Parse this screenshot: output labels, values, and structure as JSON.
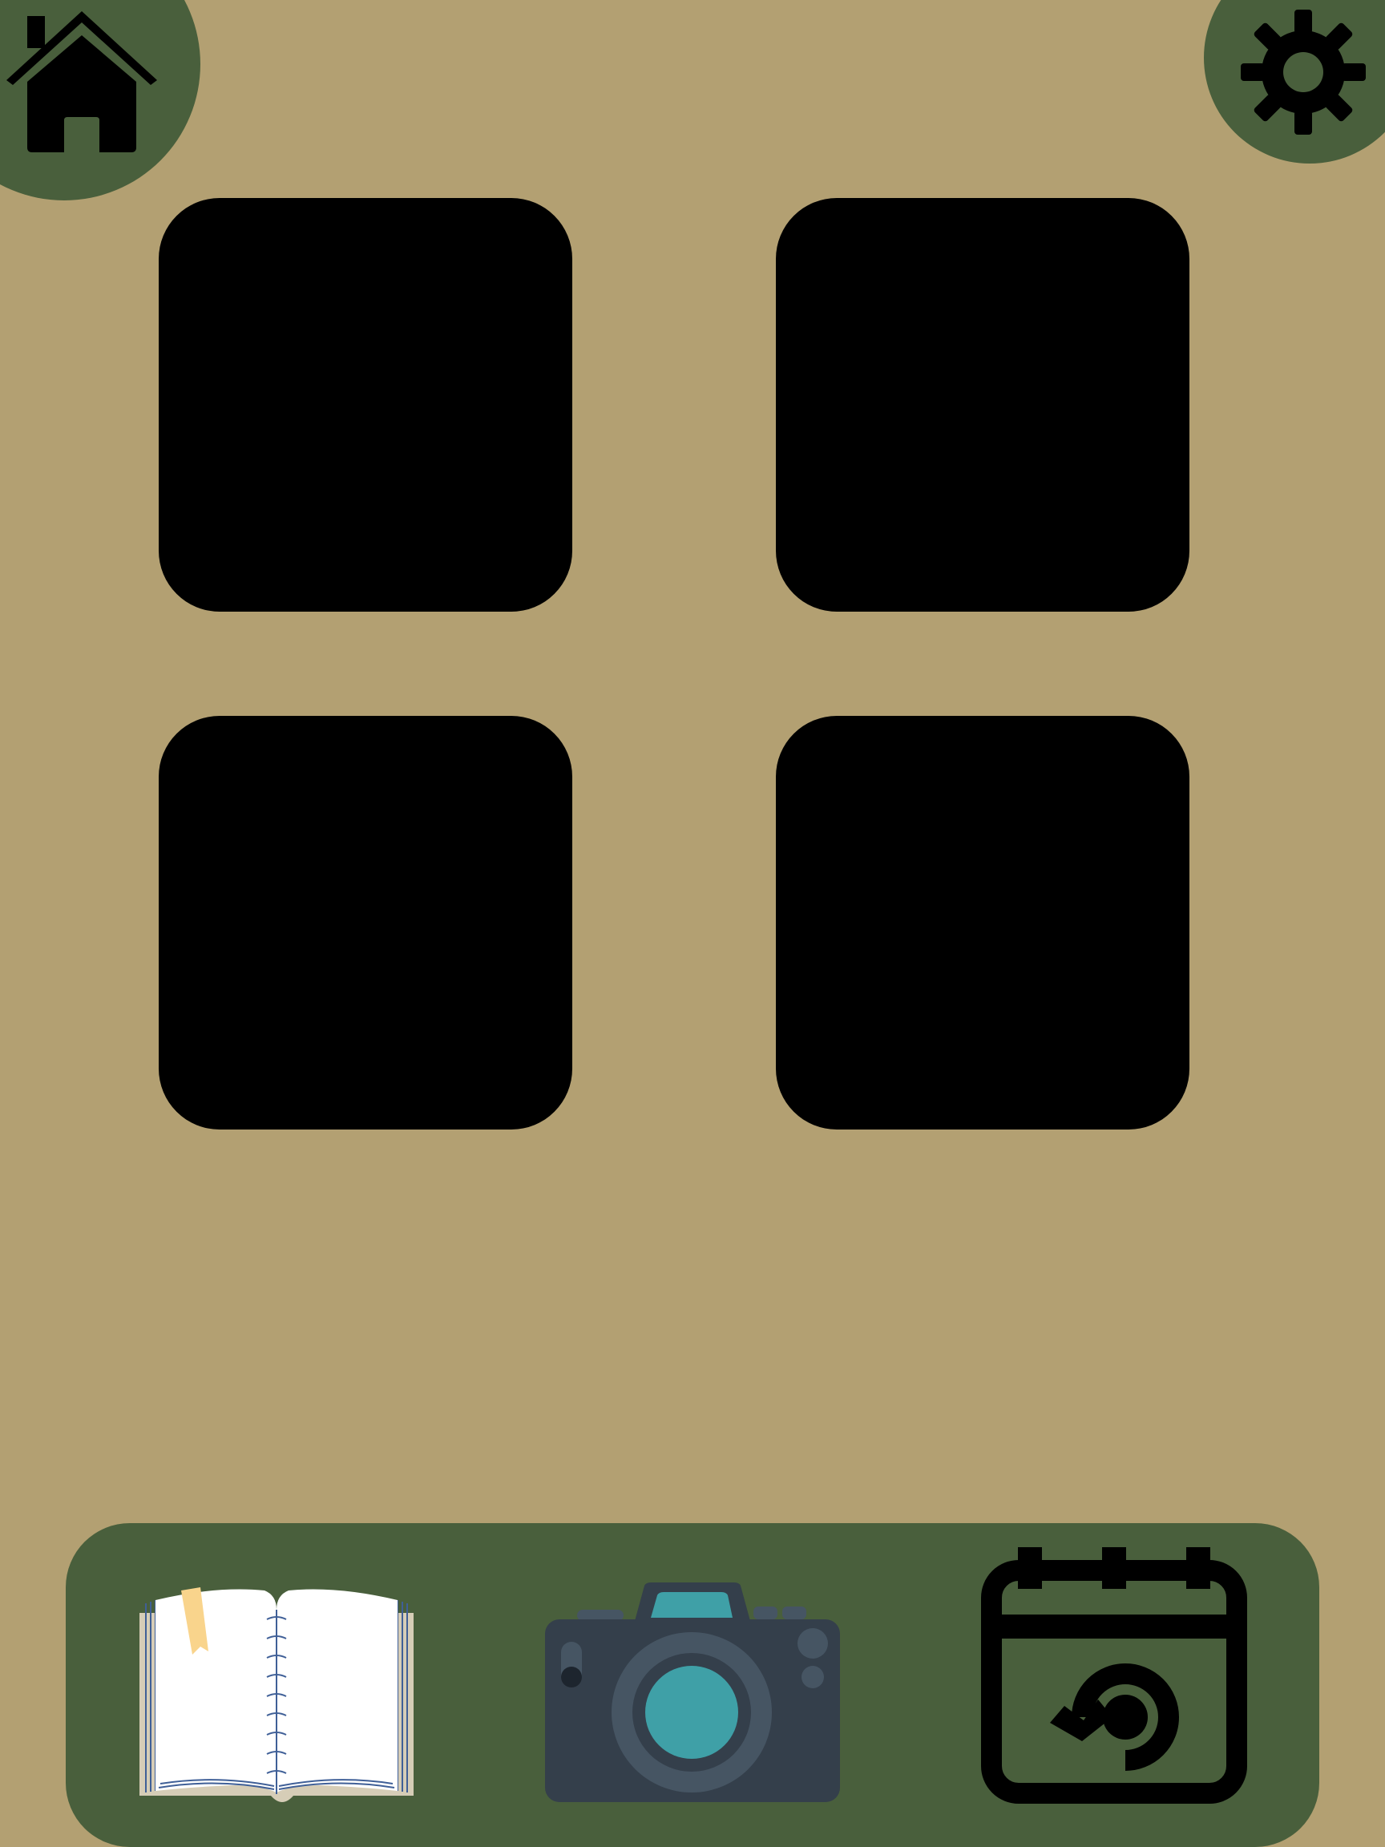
{
  "screen": {
    "title": "",
    "background_color": "#b3a072"
  },
  "colors": {
    "accent_green": "#495f3c",
    "icon_black": "#000000",
    "tile_black": "#000000",
    "camera_body": "#343f4b",
    "camera_lens": "#465563",
    "camera_teal": "#3fa0a7",
    "bookmark": "#f9d48c",
    "book_page": "#ffffff",
    "book_lines": "#3f5f97"
  },
  "top_bar": {
    "home_button": {
      "icon": "home-icon"
    },
    "settings_button": {
      "icon": "gear-icon"
    }
  },
  "grid": {
    "tiles": [
      {
        "id": "tile-1",
        "label": ""
      },
      {
        "id": "tile-2",
        "label": ""
      },
      {
        "id": "tile-3",
        "label": ""
      },
      {
        "id": "tile-4",
        "label": ""
      }
    ]
  },
  "dock": {
    "items": [
      {
        "id": "journal",
        "icon": "open-book-icon"
      },
      {
        "id": "camera",
        "icon": "camera-icon"
      },
      {
        "id": "calendar",
        "icon": "calendar-refresh-icon"
      }
    ]
  }
}
